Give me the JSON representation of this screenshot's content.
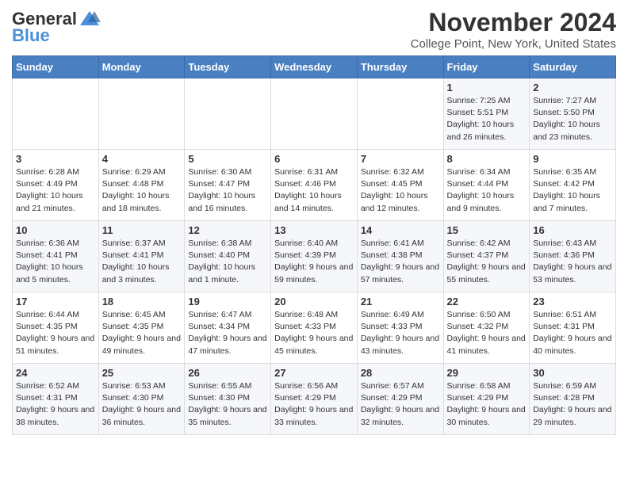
{
  "logo": {
    "general": "General",
    "blue": "Blue"
  },
  "header": {
    "title": "November 2024",
    "subtitle": "College Point, New York, United States"
  },
  "days_of_week": [
    "Sunday",
    "Monday",
    "Tuesday",
    "Wednesday",
    "Thursday",
    "Friday",
    "Saturday"
  ],
  "weeks": [
    [
      {
        "day": "",
        "info": ""
      },
      {
        "day": "",
        "info": ""
      },
      {
        "day": "",
        "info": ""
      },
      {
        "day": "",
        "info": ""
      },
      {
        "day": "",
        "info": ""
      },
      {
        "day": "1",
        "info": "Sunrise: 7:25 AM\nSunset: 5:51 PM\nDaylight: 10 hours and 26 minutes."
      },
      {
        "day": "2",
        "info": "Sunrise: 7:27 AM\nSunset: 5:50 PM\nDaylight: 10 hours and 23 minutes."
      }
    ],
    [
      {
        "day": "3",
        "info": "Sunrise: 6:28 AM\nSunset: 4:49 PM\nDaylight: 10 hours and 21 minutes."
      },
      {
        "day": "4",
        "info": "Sunrise: 6:29 AM\nSunset: 4:48 PM\nDaylight: 10 hours and 18 minutes."
      },
      {
        "day": "5",
        "info": "Sunrise: 6:30 AM\nSunset: 4:47 PM\nDaylight: 10 hours and 16 minutes."
      },
      {
        "day": "6",
        "info": "Sunrise: 6:31 AM\nSunset: 4:46 PM\nDaylight: 10 hours and 14 minutes."
      },
      {
        "day": "7",
        "info": "Sunrise: 6:32 AM\nSunset: 4:45 PM\nDaylight: 10 hours and 12 minutes."
      },
      {
        "day": "8",
        "info": "Sunrise: 6:34 AM\nSunset: 4:44 PM\nDaylight: 10 hours and 9 minutes."
      },
      {
        "day": "9",
        "info": "Sunrise: 6:35 AM\nSunset: 4:42 PM\nDaylight: 10 hours and 7 minutes."
      }
    ],
    [
      {
        "day": "10",
        "info": "Sunrise: 6:36 AM\nSunset: 4:41 PM\nDaylight: 10 hours and 5 minutes."
      },
      {
        "day": "11",
        "info": "Sunrise: 6:37 AM\nSunset: 4:41 PM\nDaylight: 10 hours and 3 minutes."
      },
      {
        "day": "12",
        "info": "Sunrise: 6:38 AM\nSunset: 4:40 PM\nDaylight: 10 hours and 1 minute."
      },
      {
        "day": "13",
        "info": "Sunrise: 6:40 AM\nSunset: 4:39 PM\nDaylight: 9 hours and 59 minutes."
      },
      {
        "day": "14",
        "info": "Sunrise: 6:41 AM\nSunset: 4:38 PM\nDaylight: 9 hours and 57 minutes."
      },
      {
        "day": "15",
        "info": "Sunrise: 6:42 AM\nSunset: 4:37 PM\nDaylight: 9 hours and 55 minutes."
      },
      {
        "day": "16",
        "info": "Sunrise: 6:43 AM\nSunset: 4:36 PM\nDaylight: 9 hours and 53 minutes."
      }
    ],
    [
      {
        "day": "17",
        "info": "Sunrise: 6:44 AM\nSunset: 4:35 PM\nDaylight: 9 hours and 51 minutes."
      },
      {
        "day": "18",
        "info": "Sunrise: 6:45 AM\nSunset: 4:35 PM\nDaylight: 9 hours and 49 minutes."
      },
      {
        "day": "19",
        "info": "Sunrise: 6:47 AM\nSunset: 4:34 PM\nDaylight: 9 hours and 47 minutes."
      },
      {
        "day": "20",
        "info": "Sunrise: 6:48 AM\nSunset: 4:33 PM\nDaylight: 9 hours and 45 minutes."
      },
      {
        "day": "21",
        "info": "Sunrise: 6:49 AM\nSunset: 4:33 PM\nDaylight: 9 hours and 43 minutes."
      },
      {
        "day": "22",
        "info": "Sunrise: 6:50 AM\nSunset: 4:32 PM\nDaylight: 9 hours and 41 minutes."
      },
      {
        "day": "23",
        "info": "Sunrise: 6:51 AM\nSunset: 4:31 PM\nDaylight: 9 hours and 40 minutes."
      }
    ],
    [
      {
        "day": "24",
        "info": "Sunrise: 6:52 AM\nSunset: 4:31 PM\nDaylight: 9 hours and 38 minutes."
      },
      {
        "day": "25",
        "info": "Sunrise: 6:53 AM\nSunset: 4:30 PM\nDaylight: 9 hours and 36 minutes."
      },
      {
        "day": "26",
        "info": "Sunrise: 6:55 AM\nSunset: 4:30 PM\nDaylight: 9 hours and 35 minutes."
      },
      {
        "day": "27",
        "info": "Sunrise: 6:56 AM\nSunset: 4:29 PM\nDaylight: 9 hours and 33 minutes."
      },
      {
        "day": "28",
        "info": "Sunrise: 6:57 AM\nSunset: 4:29 PM\nDaylight: 9 hours and 32 minutes."
      },
      {
        "day": "29",
        "info": "Sunrise: 6:58 AM\nSunset: 4:29 PM\nDaylight: 9 hours and 30 minutes."
      },
      {
        "day": "30",
        "info": "Sunrise: 6:59 AM\nSunset: 4:28 PM\nDaylight: 9 hours and 29 minutes."
      }
    ]
  ]
}
